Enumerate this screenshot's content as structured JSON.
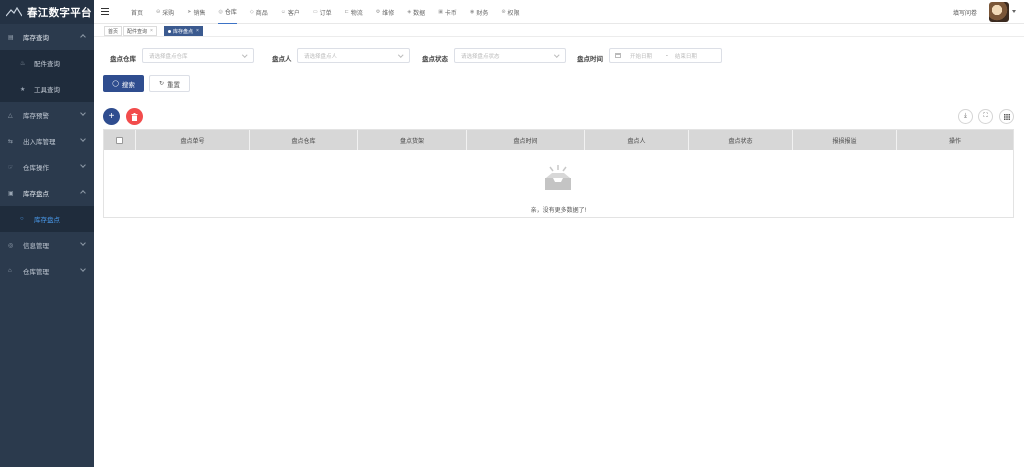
{
  "brand": {
    "title": "春江数字平台"
  },
  "sidebar": {
    "groups": [
      {
        "label": "库存查询",
        "open": true,
        "children": [
          {
            "label": "配件查询",
            "active": false
          },
          {
            "label": "工具查询",
            "active": false
          }
        ]
      },
      {
        "label": "库存预警",
        "open": false
      },
      {
        "label": "出入库管理",
        "open": false
      },
      {
        "label": "仓库操作",
        "open": false
      },
      {
        "label": "库存盘点",
        "open": true,
        "children": [
          {
            "label": "库存盘点",
            "active": true
          }
        ]
      },
      {
        "label": "信息管理",
        "open": false
      },
      {
        "label": "仓库管理",
        "open": false
      }
    ]
  },
  "topnav": {
    "items": [
      "首页",
      "采购",
      "销售",
      "仓库",
      "商品",
      "客户",
      "订单",
      "物流",
      "维修",
      "数据",
      "卡币",
      "财务",
      "权限"
    ],
    "active_index": 3
  },
  "header": {
    "survey_label": "填写问卷"
  },
  "tabs": [
    {
      "label": "首页",
      "closable": false,
      "active": false
    },
    {
      "label": "配件查询",
      "closable": true,
      "active": false
    },
    {
      "label": "库存盘点",
      "closable": true,
      "active": true
    }
  ],
  "filters": {
    "warehouse": {
      "label": "盘点仓库",
      "placeholder": "请选择盘点仓库"
    },
    "person": {
      "label": "盘点人",
      "placeholder": "请选择盘点人"
    },
    "status": {
      "label": "盘点状态",
      "placeholder": "请选择盘点状态"
    },
    "time": {
      "label": "盘点时间",
      "start_placeholder": "开始日期",
      "separator": "-",
      "end_placeholder": "结束日期"
    }
  },
  "actions": {
    "search_label": "搜索",
    "reset_label": "重置",
    "add_symbol": "+",
    "delete_symbol": "🗑"
  },
  "table": {
    "columns": [
      "盘点单号",
      "盘点仓库",
      "盘点货架",
      "盘点时间",
      "盘点人",
      "盘点状态",
      "报损报溢",
      "操作"
    ],
    "empty_text": "亲，没有更多数据了!"
  },
  "colors": {
    "sidebar_bg": "#2b3a4d",
    "primary": "#2f4d8f",
    "danger": "#f24c4c",
    "active_menu": "#4a9cf0"
  }
}
